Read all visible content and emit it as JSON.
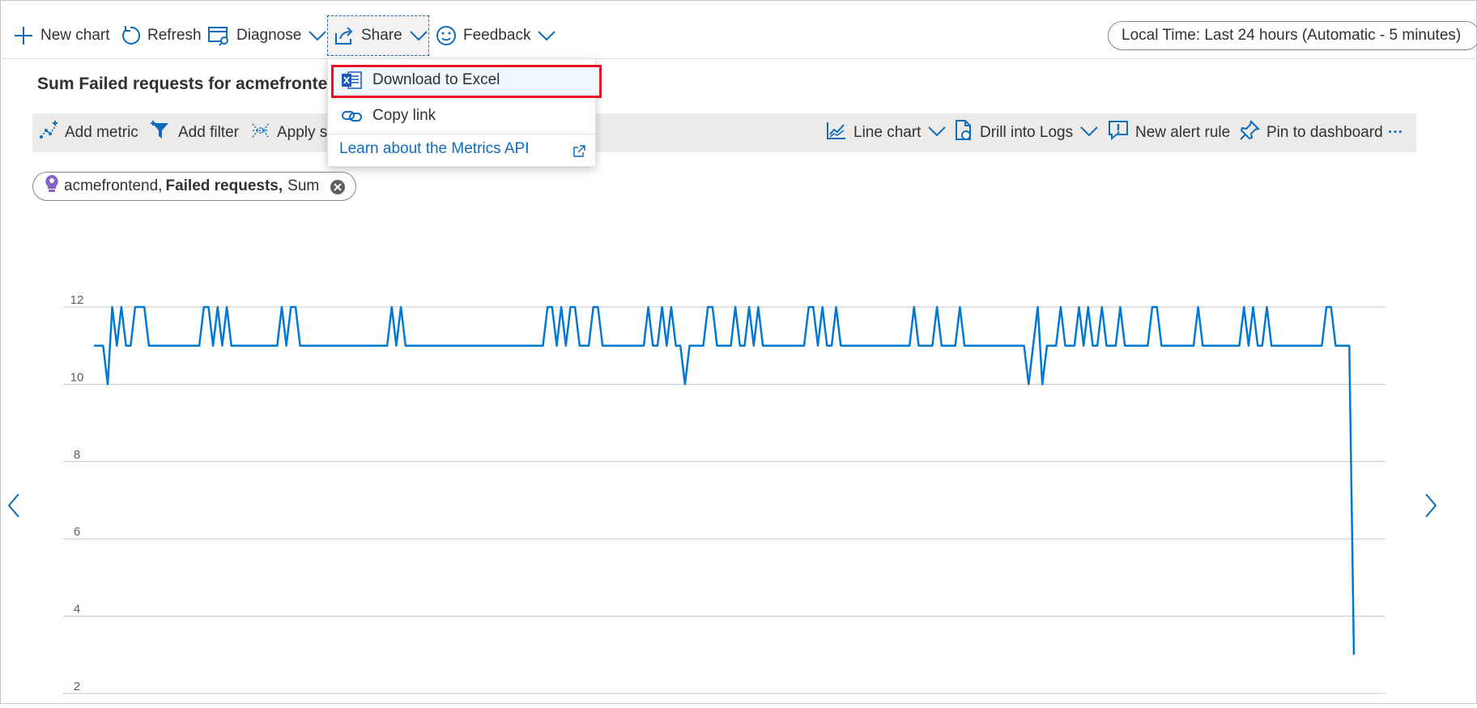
{
  "command_bar": {
    "new_chart": "New chart",
    "refresh": "Refresh",
    "diagnose": "Diagnose",
    "share": "Share",
    "feedback": "Feedback",
    "time_range": "Local Time: Last 24 hours (Automatic - 5 minutes)"
  },
  "share_menu": {
    "items": [
      "Download to Excel",
      "Copy link"
    ],
    "link": "Learn about the Metrics API",
    "highlighted": "Download to Excel"
  },
  "chart_title": "Sum Failed requests for acmefrontend",
  "toolbar": {
    "add_metric": "Add metric",
    "add_filter": "Add filter",
    "apply_splitting": "Apply sp",
    "line_chart": "Line chart",
    "drill_logs": "Drill into Logs",
    "new_alert": "New alert rule",
    "pin": "Pin to dashboard",
    "more": "···"
  },
  "metric_pill": {
    "resource": "acmefrontend,",
    "metric": "Failed requests,",
    "aggregation": "Sum"
  },
  "colors": {
    "accent": "#0f6cbd",
    "line": "#0078d4",
    "highlight_border": "#e81123",
    "toolbar_bg": "#edebe9",
    "grid": "#c8c6c4"
  },
  "icons": [
    "plus-icon",
    "refresh-icon",
    "diagnose-icon",
    "share-icon",
    "smiley-icon",
    "excel-icon",
    "link-icon",
    "external-link-icon",
    "add-metric-icon",
    "funnel-icon",
    "splitting-icon",
    "line-chart-icon",
    "logs-icon",
    "alert-icon",
    "pin-icon",
    "close-icon",
    "lightbulb-icon"
  ],
  "chart_data": {
    "type": "line",
    "title": "Sum Failed requests for acmefrontend",
    "ylim": [
      2,
      12
    ],
    "yticks": [
      "12",
      "10",
      "8",
      "6",
      "4",
      "2"
    ],
    "grid": true,
    "series": [
      {
        "values": [
          11,
          11,
          11,
          10,
          12,
          11,
          12,
          11,
          11,
          12,
          12,
          12,
          11,
          11,
          11,
          11,
          11,
          11,
          11,
          11,
          11,
          11,
          11,
          11,
          12,
          12,
          11,
          12,
          11,
          12,
          11,
          11,
          11,
          11,
          11,
          11,
          11,
          11,
          11,
          11,
          11,
          12,
          11,
          12,
          12,
          11,
          11,
          11,
          11,
          11,
          11,
          11,
          11,
          11,
          11,
          11,
          11,
          11,
          11,
          11,
          11,
          11,
          11,
          11,
          11,
          12,
          11,
          12,
          11,
          11,
          11,
          11,
          11,
          11,
          11,
          11,
          11,
          11,
          11,
          11,
          11,
          11,
          11,
          11,
          11,
          11,
          11,
          11,
          11,
          11,
          11,
          11,
          11,
          11,
          11,
          11,
          11,
          11,
          11,
          12,
          12,
          11,
          12,
          11,
          12,
          12,
          11,
          11,
          11,
          12,
          12,
          11,
          11,
          11,
          11,
          11,
          11,
          11,
          11,
          11,
          11,
          12,
          11,
          11,
          12,
          11,
          12,
          11,
          11,
          10,
          11,
          11,
          11,
          11,
          12,
          12,
          11,
          11,
          11,
          11,
          12,
          11,
          11,
          12,
          11,
          12,
          11,
          11,
          11,
          11,
          11,
          11,
          11,
          11,
          11,
          11,
          12,
          12,
          11,
          12,
          11,
          11,
          12,
          11,
          11,
          11,
          11,
          11,
          11,
          11,
          11,
          11,
          11,
          11,
          11,
          11,
          11,
          11,
          11,
          12,
          11,
          11,
          11,
          11,
          12,
          11,
          11,
          11,
          11,
          12,
          11,
          11,
          11,
          11,
          11,
          11,
          11,
          11,
          11,
          11,
          11,
          11,
          11,
          11,
          10,
          11,
          12,
          10,
          11,
          11,
          11,
          12,
          11,
          11,
          11,
          12,
          11,
          12,
          11,
          11,
          12,
          11,
          11,
          11,
          12,
          11,
          11,
          11,
          11,
          11,
          11,
          12,
          12,
          11,
          11,
          11,
          11,
          11,
          11,
          11,
          11,
          12,
          11,
          11,
          11,
          11,
          11,
          11,
          11,
          11,
          11,
          12,
          11,
          12,
          11,
          11,
          12,
          11,
          11,
          11,
          11,
          11,
          11,
          11,
          11,
          11,
          11,
          11,
          11,
          12,
          12,
          11,
          11,
          11,
          11,
          3
        ]
      }
    ]
  }
}
